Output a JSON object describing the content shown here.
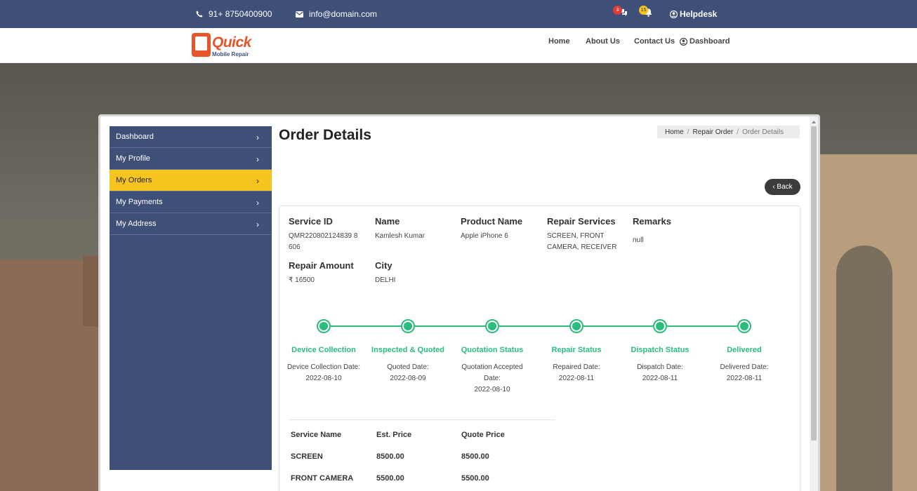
{
  "topbar": {
    "phone": "91+ 8750400900",
    "email": "info@domain.com",
    "chat_count": "3",
    "bell_count": "15",
    "helpdesk": "Helpdesk"
  },
  "brand": {
    "word1": "Quick",
    "word2": "Mobile Repair"
  },
  "nav": {
    "home": "Home",
    "about": "About Us",
    "contact": "Contact Us",
    "dashboard": "Dashboard"
  },
  "sidebar": {
    "items": [
      {
        "label": "Dashboard",
        "active": false
      },
      {
        "label": "My Profile",
        "active": false
      },
      {
        "label": "My Orders",
        "active": true
      },
      {
        "label": "My Payments",
        "active": false
      },
      {
        "label": "My Address",
        "active": false
      }
    ]
  },
  "page": {
    "title": "Order Details",
    "breadcrumb": [
      "Home",
      "Repair Order",
      "Order Details"
    ],
    "back": "‹ Back"
  },
  "order": {
    "service_id_label": "Service ID",
    "service_id": "QMR220802124839 8606",
    "name_label": "Name",
    "name": "Kamlesh Kumar",
    "product_label": "Product Name",
    "product": "Apple iPhone 6",
    "services_label": "Repair Services",
    "services": "SCREEN, FRONT CAMERA, RECEIVER",
    "remarks_label": "Remarks",
    "remarks": "null",
    "amount_label": "Repair Amount",
    "amount": "₹ 16500",
    "city_label": "City",
    "city": "DELHI"
  },
  "timeline": [
    {
      "label": "Device Collection",
      "date_label": "Device Collection Date:",
      "date": "2022-08-10"
    },
    {
      "label": "Inspected & Quoted",
      "date_label": "Quoted Date:",
      "date": "2022-08-09"
    },
    {
      "label": "Quotation Status",
      "date_label": "Quotation Accepted Date:",
      "date": "2022-08-10"
    },
    {
      "label": "Repair Status",
      "date_label": "Repaired Date:",
      "date": "2022-08-11"
    },
    {
      "label": "Dispatch Status",
      "date_label": "Dispatch Date:",
      "date": "2022-08-11"
    },
    {
      "label": "Delivered",
      "date_label": "Delivered Date:",
      "date": "2022-08-11"
    }
  ],
  "services_table": {
    "headers": [
      "Service Name",
      "Est. Price",
      "Quote Price"
    ],
    "rows": [
      [
        "SCREEN",
        "8500.00",
        "8500.00"
      ],
      [
        "FRONT CAMERA",
        "5500.00",
        "5500.00"
      ]
    ]
  },
  "colors": {
    "brand_blue": "#3f5078",
    "active_yellow": "#f5c41f",
    "timeline_green": "#2bbd7e",
    "logo_orange": "#e8542a"
  }
}
